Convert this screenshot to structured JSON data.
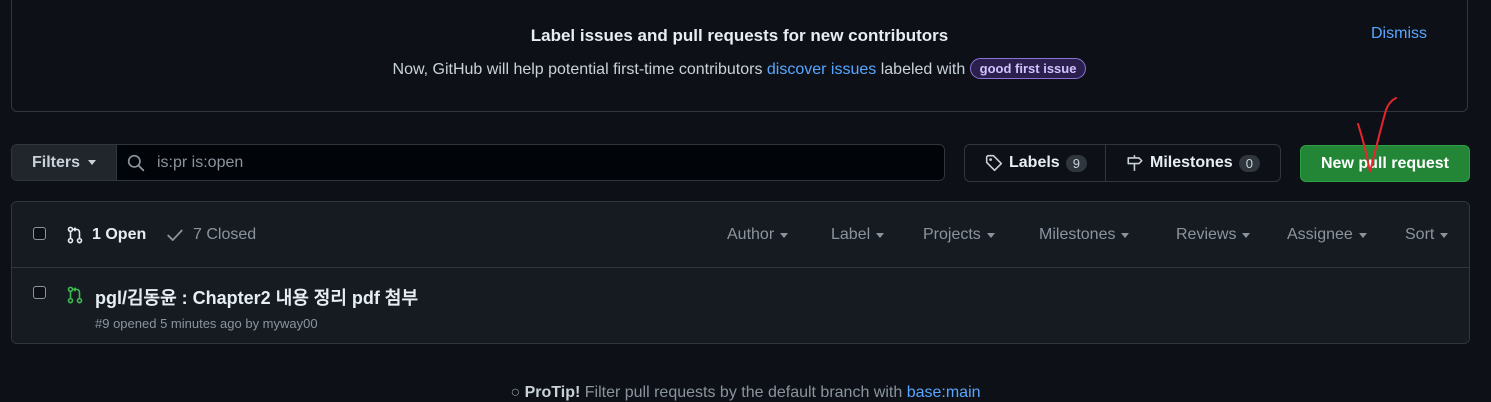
{
  "banner": {
    "title": "Label issues and pull requests for new contributors",
    "text_before": "Now, GitHub will help potential first-time contributors",
    "link": "discover issues",
    "text_after": "labeled with",
    "label": "good first issue",
    "dismiss": "Dismiss"
  },
  "toolbar": {
    "filters_label": "Filters",
    "search_value": "is:pr is:open",
    "labels_label": "Labels",
    "labels_count": "9",
    "milestones_label": "Milestones",
    "milestones_count": "0",
    "new_pr_label": "New pull request"
  },
  "list": {
    "open_label": "1 Open",
    "closed_label": "7 Closed",
    "filters": [
      "Author",
      "Label",
      "Projects",
      "Milestones",
      "Reviews",
      "Assignee",
      "Sort"
    ],
    "rows": [
      {
        "title": "pgl/김동윤 : Chapter2 내용 정리 pdf 첨부",
        "meta": "#9 opened 5 minutes ago by myway00"
      }
    ]
  },
  "protip": {
    "bold": "ProTip!",
    "text": "Filter pull requests by the default branch with",
    "link": "base:main"
  },
  "colors": {
    "background": "#0d1117",
    "accent_link": "#58a6ff",
    "primary_button": "#238636",
    "open_icon": "#3fb950",
    "annotation": "#e5262b"
  },
  "icons": [
    "search-icon",
    "tag-icon",
    "milestone-icon",
    "git-pull-request-icon",
    "check-icon",
    "light-bulb-icon"
  ]
}
